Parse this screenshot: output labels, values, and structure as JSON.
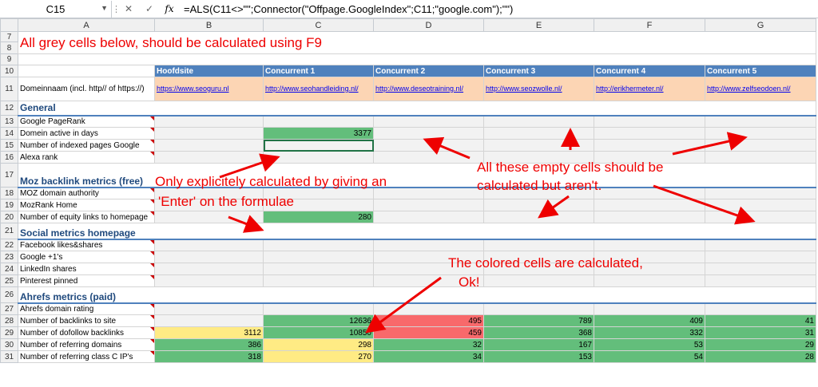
{
  "formula_bar": {
    "cell": "C15",
    "fx": "fx",
    "formula": "=ALS(C11<>\"\";Connector(\"Offpage.GoogleIndex\";C11;\"google.com\");\"\")"
  },
  "columns": [
    "A",
    "B",
    "C",
    "D",
    "E",
    "F",
    "G"
  ],
  "title": "All grey cells below, should be calculated using F9",
  "header_row": [
    "",
    "Hoofdsite",
    "Concurrent 1",
    "Concurrent 2",
    "Concurrent 3",
    "Concurrent 4",
    "Concurrent 5"
  ],
  "domain_label": "Domeinnaam (incl. http// of https://)",
  "domains": [
    "https://www.seoguru.nl",
    "http://www.seohandleiding.nl/",
    "http://www.deseotraining.nl/",
    "http://www.seozwolle.nl/",
    "http://erikhermeter.nl/",
    "http://www.zelfseodoen.nl/"
  ],
  "sections": {
    "general": "General",
    "moz": "Moz backlink metrics (free)",
    "social": "Social metrics homepage",
    "ahrefs": "Ahrefs metrics (paid)"
  },
  "labels": {
    "r13": "Google PageRank",
    "r14": "Domein active in days",
    "r15": "Number of indexed pages Google",
    "r16": "Alexa rank",
    "r18": "MOZ domain authority",
    "r19": "MozRank Home",
    "r20": "Number of equity links to homepage",
    "r22": "Facebook likes&shares",
    "r23": "Google +1's",
    "r24": "LinkedIn shares",
    "r25": "Pinterest pinned",
    "r27": "Ahrefs domain rating",
    "r28": "Number of backlinks to site",
    "r29": "Number of  dofollow backlinks",
    "r30": "Number of  referring domains",
    "r31": "Number of  referring class C IP's"
  },
  "values": {
    "c14": "3377",
    "c20": "280",
    "r28": [
      "",
      "12636",
      "495",
      "789",
      "409",
      "41"
    ],
    "r29": [
      "3112",
      "10850",
      "459",
      "368",
      "332",
      "31"
    ],
    "r30": [
      "386",
      "298",
      "32",
      "167",
      "53",
      "29"
    ],
    "r31": [
      "318",
      "270",
      "34",
      "153",
      "54",
      "28"
    ]
  },
  "notes": {
    "n1": "Only explicitely calculated by giving an",
    "n2": "'Enter' on the formulae",
    "n3": "All these empty cells should be",
    "n4": "calculated but aren't.",
    "n5": "The colored cells are calculated,",
    "n6": "Ok!"
  }
}
